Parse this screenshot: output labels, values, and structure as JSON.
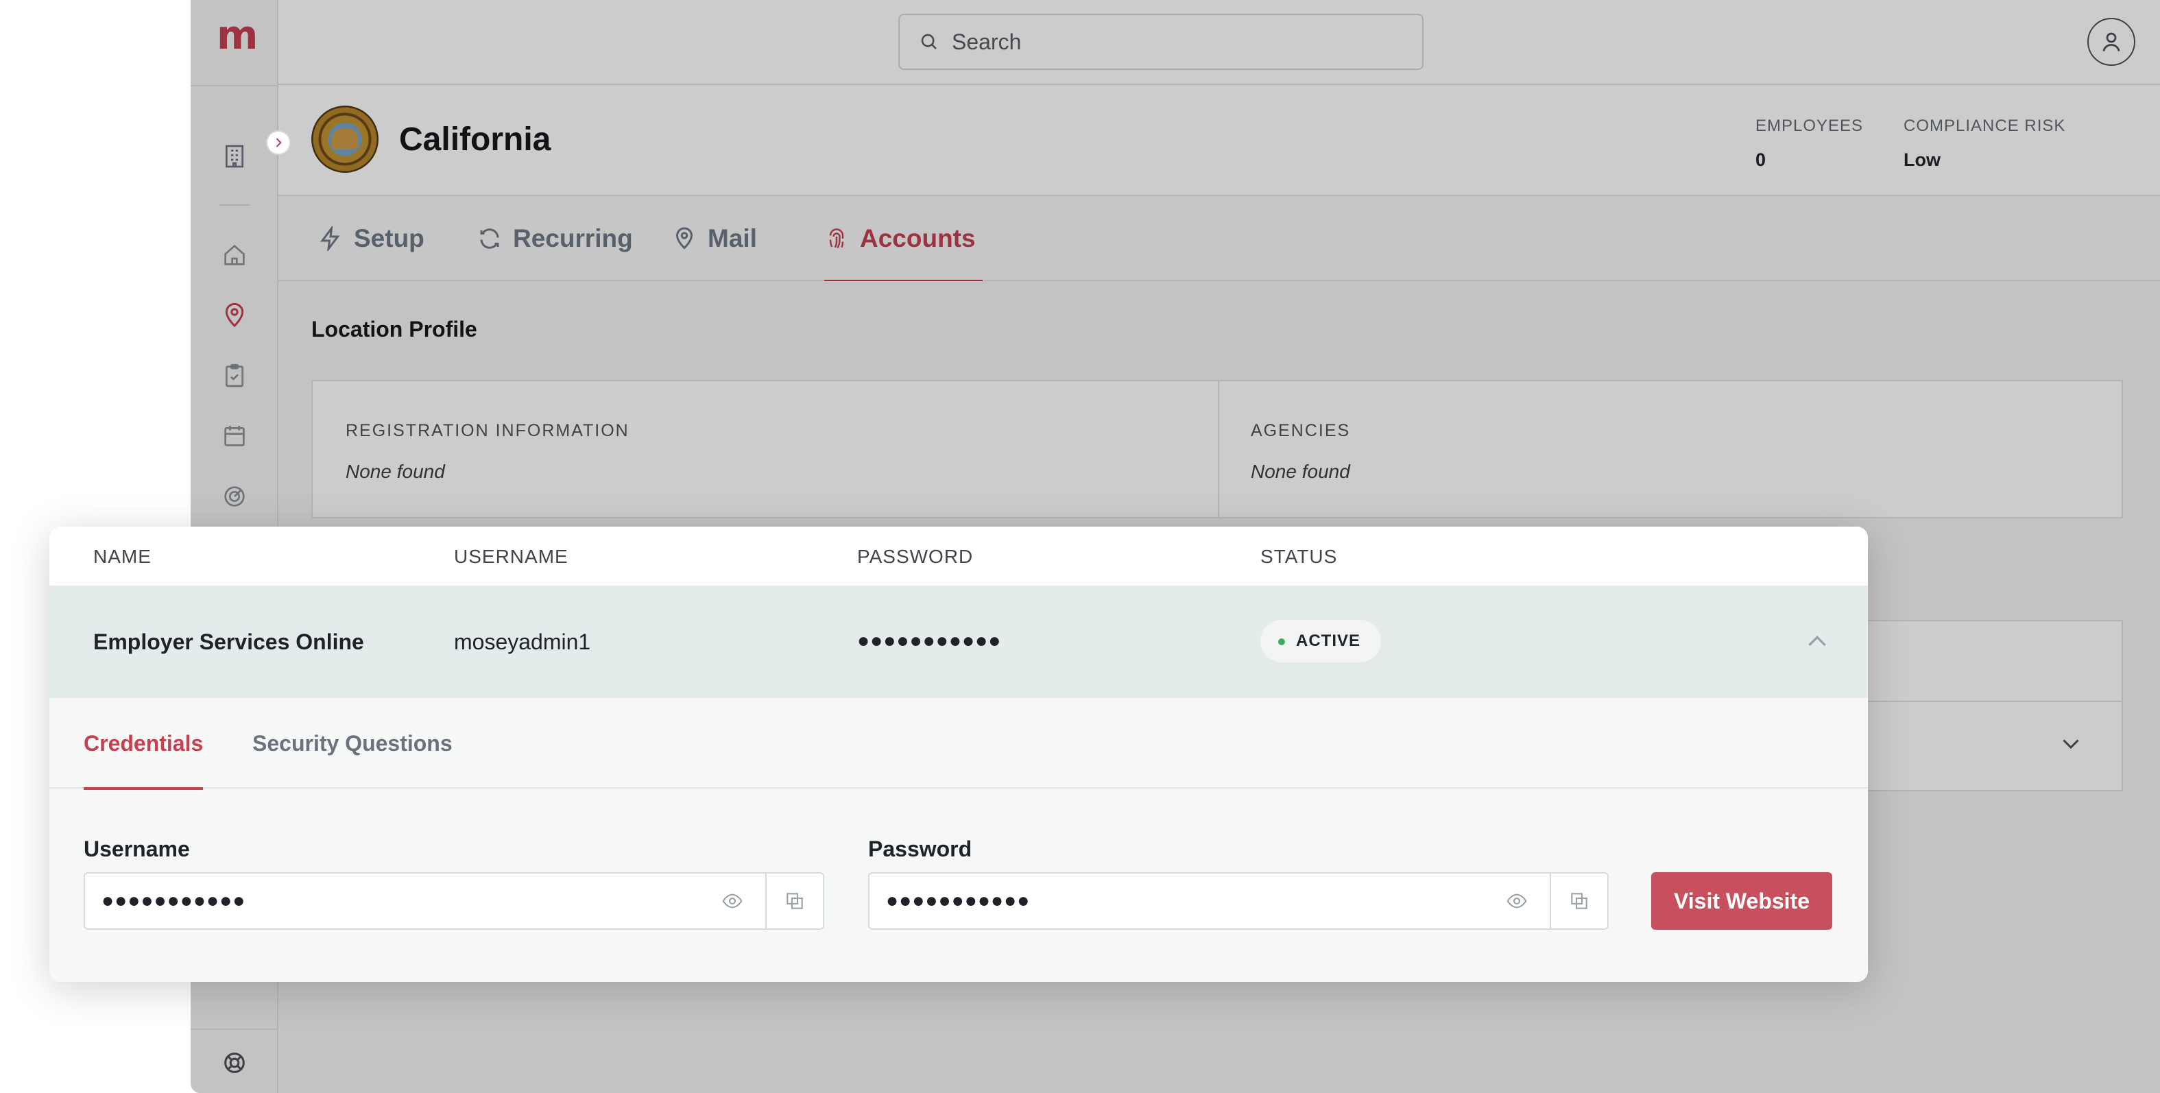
{
  "app": {
    "logo": "m",
    "search": {
      "placeholder": "Search"
    },
    "location": {
      "title": "California"
    },
    "stats": [
      {
        "label": "EMPLOYEES",
        "value": "0"
      },
      {
        "label": "COMPLIANCE RISK",
        "value": "Low"
      }
    ],
    "tabs": [
      {
        "label": "Setup",
        "icon": "bolt-icon"
      },
      {
        "label": "Recurring",
        "icon": "refresh-icon"
      },
      {
        "label": "Mail",
        "icon": "map-pin-icon"
      },
      {
        "label": "Accounts",
        "icon": "fingerprint-icon",
        "active": true
      }
    ],
    "section_title": "Location Profile",
    "profile": {
      "registration": {
        "label": "REGISTRATION INFORMATION",
        "value": "None found"
      },
      "agencies": {
        "label": "AGENCIES",
        "value": "None found"
      }
    }
  },
  "accounts_table": {
    "columns": [
      "NAME",
      "USERNAME",
      "PASSWORD",
      "STATUS"
    ],
    "row": {
      "name": "Employer Services Online",
      "username": "moseyadmin1",
      "password": "●●●●●●●●●●●",
      "status": "ACTIVE"
    },
    "detail_tabs": [
      {
        "label": "Credentials",
        "active": true
      },
      {
        "label": "Security Questions",
        "active": false
      }
    ],
    "fields": {
      "username": {
        "label": "Username",
        "value": "●●●●●●●●●●●"
      },
      "password": {
        "label": "Password",
        "value": "●●●●●●●●●●●"
      }
    },
    "visit_button": "Visit Website"
  },
  "colors": {
    "accent": "#c54050",
    "status_active": "#3fae5a",
    "row_highlight": "#e3ebeb"
  }
}
